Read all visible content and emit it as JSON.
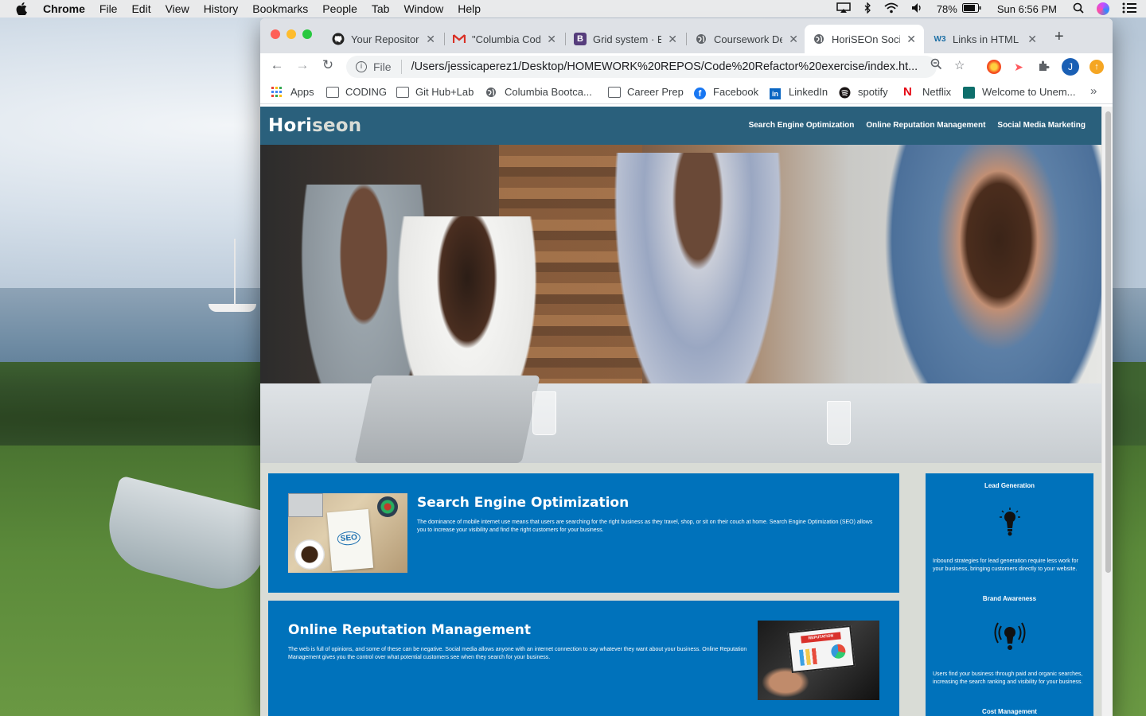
{
  "menubar": {
    "app": "Chrome",
    "items": [
      "File",
      "Edit",
      "View",
      "History",
      "Bookmarks",
      "People",
      "Tab",
      "Window",
      "Help"
    ],
    "battery": "78%",
    "clock": "Sun 6:56 PM"
  },
  "tabs": [
    {
      "title": "Your Repositori",
      "icon": "github-icon",
      "active": false
    },
    {
      "title": "\"Columbia Cod",
      "icon": "gmail-icon",
      "active": false
    },
    {
      "title": "Grid system · B",
      "icon": "bootstrap-icon",
      "active": false
    },
    {
      "title": "Coursework De",
      "icon": "globe-icon",
      "active": false
    },
    {
      "title": "HoriSEOn Soci",
      "icon": "globe-icon",
      "active": true
    },
    {
      "title": "Links in HTML",
      "icon": "w3schools-icon",
      "active": false
    }
  ],
  "omnibox": {
    "scheme": "File",
    "url": "/Users/jessicaperez1/Desktop/HOMEWORK%20REPOS/Code%20Refactor%20exercise/index.ht..."
  },
  "profile_initial": "J",
  "bookmarks": [
    "Apps",
    "CODING",
    "Git Hub+Lab",
    "Columbia Bootca...",
    "Career Prep",
    "Facebook",
    "LinkedIn",
    "spotify",
    "Netflix",
    "Welcome to Unem..."
  ],
  "bookmarks_more": "»",
  "site": {
    "logo_main": "Hori",
    "logo_accent": "seon",
    "nav": [
      "Search Engine Optimization",
      "Online Reputation Management",
      "Social Media Marketing"
    ],
    "seo": {
      "title": "Search Engine Optimization",
      "text": "The dominance of mobile internet use means that users are searching for the right business as they travel, shop, or sit on their couch at home. Search Engine Optimization (SEO) allows you to increase your visibility and find the right customers for your business.",
      "image_word": "SEO"
    },
    "orm": {
      "title": "Online Reputation Management",
      "text": "The web is full of opinions, and some of these can be negative. Social media allows anyone with an internet connection to say whatever they want about your business. Online Reputation Management gives you the control over what potential customers see when they search for your business.",
      "image_word": "REPUTATION"
    },
    "sidebar": [
      {
        "title": "Lead Generation",
        "text": "Inbound strategies for lead generation require less work for your business, bringing customers directly to your website.",
        "icon": "lightbulb-icon"
      },
      {
        "title": "Brand Awareness",
        "text": "Users find your business through paid and organic searches, increasing the search ranking and visibility for your business.",
        "icon": "broadcast-bulb-icon"
      },
      {
        "title": "Cost Management",
        "text": "",
        "icon": ""
      }
    ]
  }
}
